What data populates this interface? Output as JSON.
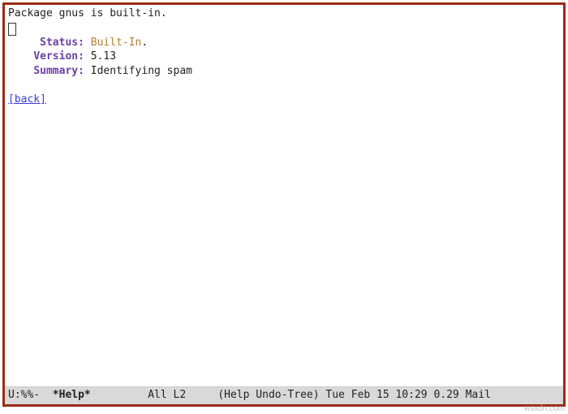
{
  "header_line": "Package gnus is built-in.",
  "fields": {
    "status_label": "Status:",
    "status_value": "Built-In",
    "status_suffix": ".",
    "version_label": "Version:",
    "version_value": "5.13",
    "summary_label": "Summary:",
    "summary_value": "Identifying spam"
  },
  "back_link": "[back]",
  "modeline": {
    "left": "U:%%-",
    "buffer": "*Help*",
    "position": "All L2",
    "modes": "(Help Undo-Tree)",
    "timestamp": "Tue Feb 15 10:29",
    "load": "0.29",
    "extra": "Mail"
  },
  "watermark": "wsxdn.com"
}
